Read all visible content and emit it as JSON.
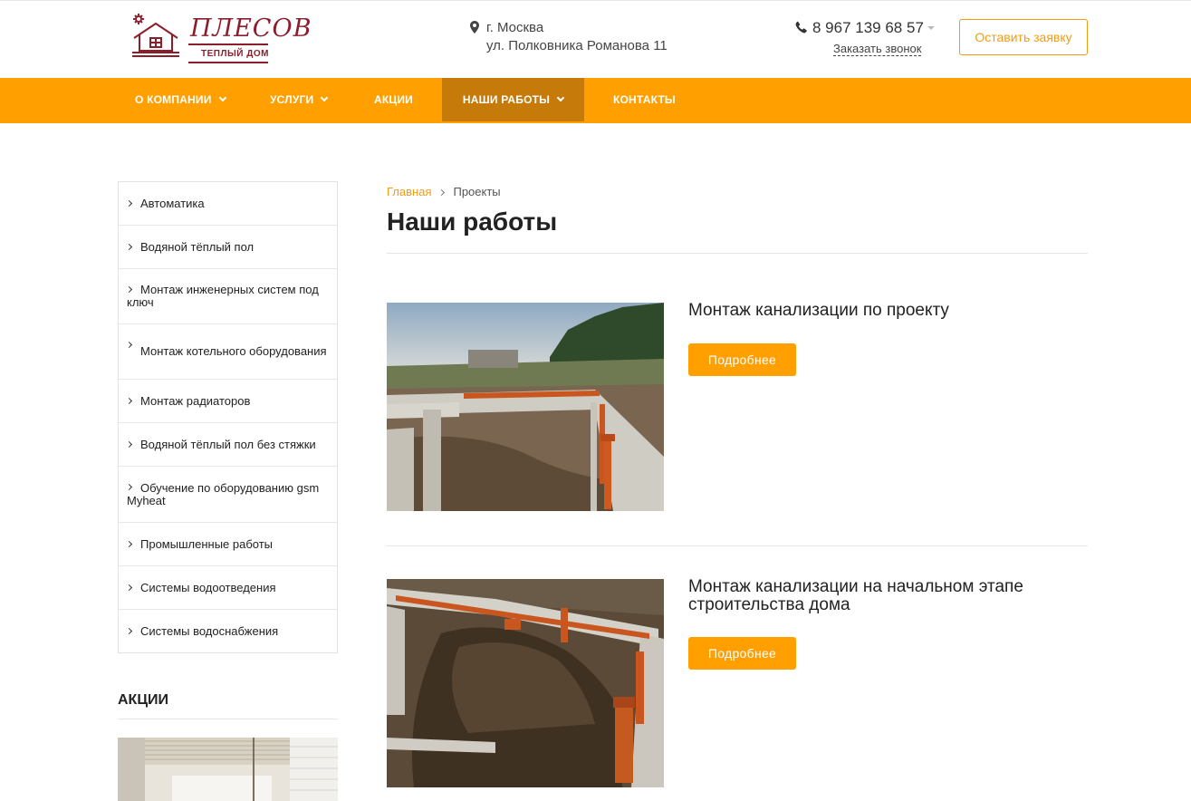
{
  "brand": {
    "name": "ПЛЕСОВ",
    "tagline": "ТЕПЛЫЙ ДОМ",
    "color": "#8b1e2b"
  },
  "header": {
    "city": "г. Москва",
    "street": "ул. Полковника Романова 11",
    "phone": "8 967 139 68 57",
    "callback_label": "Заказать звонок",
    "order_button": "Оставить заявку"
  },
  "nav": {
    "accent": "#ff9f00",
    "items": [
      {
        "label": "О КОМПАНИИ",
        "dropdown": true
      },
      {
        "label": "УСЛУГИ",
        "dropdown": true
      },
      {
        "label": "АКЦИИ",
        "dropdown": false
      },
      {
        "label": "НАШИ РАБОТЫ",
        "dropdown": true,
        "active": true
      },
      {
        "label": "КОНТАКТЫ",
        "dropdown": false
      }
    ]
  },
  "sidebar": {
    "items": [
      "Автоматика",
      "Водяной тёплый пол",
      "Монтаж инженерных систем под ключ",
      "Монтаж котельного оборудования",
      "Монтаж радиаторов",
      "Водяной тёплый пол без стяжки",
      "Обучение по оборудованию gsm Myheat",
      "Промышленные работы",
      "Системы водоотведения",
      "Системы водоснабжения"
    ],
    "promo_title": "АКЦИИ"
  },
  "breadcrumb": {
    "home": "Главная",
    "current": "Проекты"
  },
  "page_title": "Наши работы",
  "projects": [
    {
      "title": "Монтаж канализации по проекту",
      "button": "Подробнее"
    },
    {
      "title": "Монтаж канализации на начальном этапе строительства дома",
      "button": "Подробнее"
    }
  ]
}
